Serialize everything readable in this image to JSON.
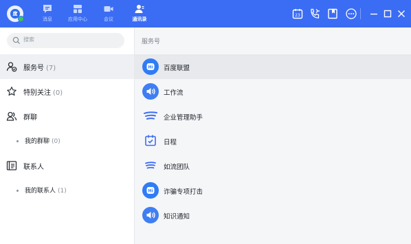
{
  "avatar": {
    "initial": "度"
  },
  "nav": {
    "tabs": [
      {
        "label": "消息",
        "icon": "message-icon"
      },
      {
        "label": "应用中心",
        "icon": "app-center-icon"
      },
      {
        "label": "会议",
        "icon": "video-camera-icon"
      },
      {
        "label": "通讯录",
        "icon": "contacts-icon",
        "active": true
      }
    ]
  },
  "toolbar": {
    "icons": [
      "calendar-icon",
      "phone-icon",
      "bookmark-icon",
      "more-icon"
    ],
    "window": [
      "minimize-icon",
      "maximize-icon",
      "close-icon"
    ]
  },
  "search": {
    "placeholder": "搜索"
  },
  "sidebar": {
    "items": [
      {
        "label": "服务号",
        "count": "(7)",
        "selected": true
      },
      {
        "label": "特别关注",
        "count": "(0)"
      },
      {
        "label": "群聊",
        "count": ""
      },
      {
        "label": "我的群聊",
        "count": "(0)"
      },
      {
        "label": "联系人",
        "count": ""
      },
      {
        "label": "我的联系人",
        "count": "(1)"
      }
    ]
  },
  "main": {
    "section_title": "服务号",
    "items": [
      {
        "label": "百度联盟",
        "icon": "hi-logo-icon",
        "selected": true
      },
      {
        "label": "工作流",
        "icon": "speaker-icon"
      },
      {
        "label": "企业管理助手",
        "icon": "stream-lines-icon"
      },
      {
        "label": "日程",
        "icon": "calendar-check-icon"
      },
      {
        "label": "如流团队",
        "icon": "stream-lines-icon"
      },
      {
        "label": "诈骗专项打击",
        "icon": "hi-logo-icon"
      },
      {
        "label": "知识通知",
        "icon": "speaker-icon"
      }
    ]
  },
  "colors": {
    "accent": "#3b6cf4",
    "online": "#35c759",
    "icon_blue": "#2f6cf0"
  }
}
